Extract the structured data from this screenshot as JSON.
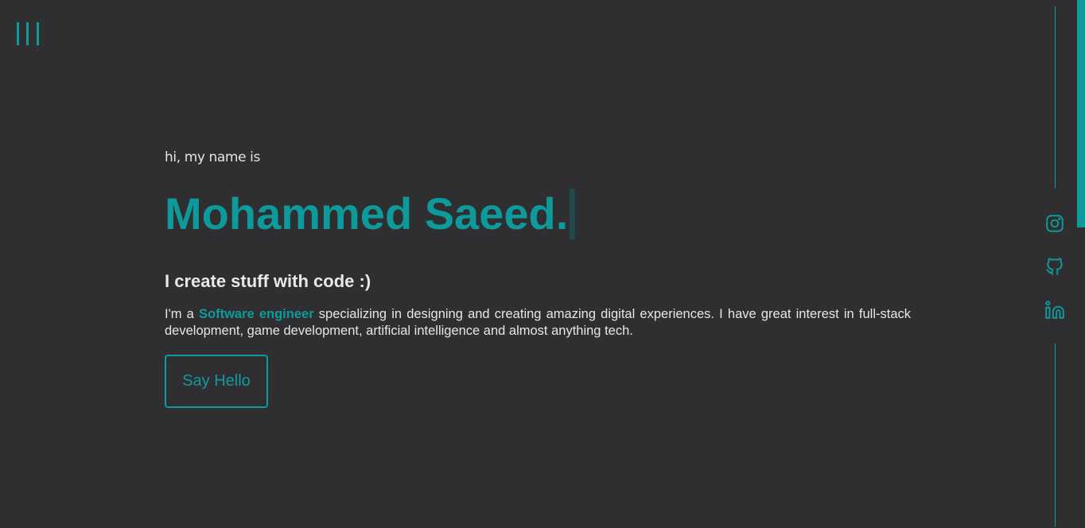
{
  "colors": {
    "background": "#2f2f31",
    "accent": "#0e9a9b",
    "text": "#e6e6e6"
  },
  "nav": {
    "menu_icon": "menu-bars-icon"
  },
  "hero": {
    "intro": "hi, my name is",
    "name": "Mohammed Saeed.",
    "tagline": "I create stuff with code :)",
    "bio_prefix": "I'm a ",
    "bio_highlight": "Software engineer",
    "bio_suffix": " specializing in designing and creating amazing digital experiences. I have great interest in full-stack development, game development, artificial intelligence and almost anything tech.",
    "cta_label": "Say Hello"
  },
  "social": {
    "items": [
      {
        "icon": "instagram-icon"
      },
      {
        "icon": "github-icon"
      },
      {
        "icon": "linkedin-icon"
      }
    ]
  }
}
